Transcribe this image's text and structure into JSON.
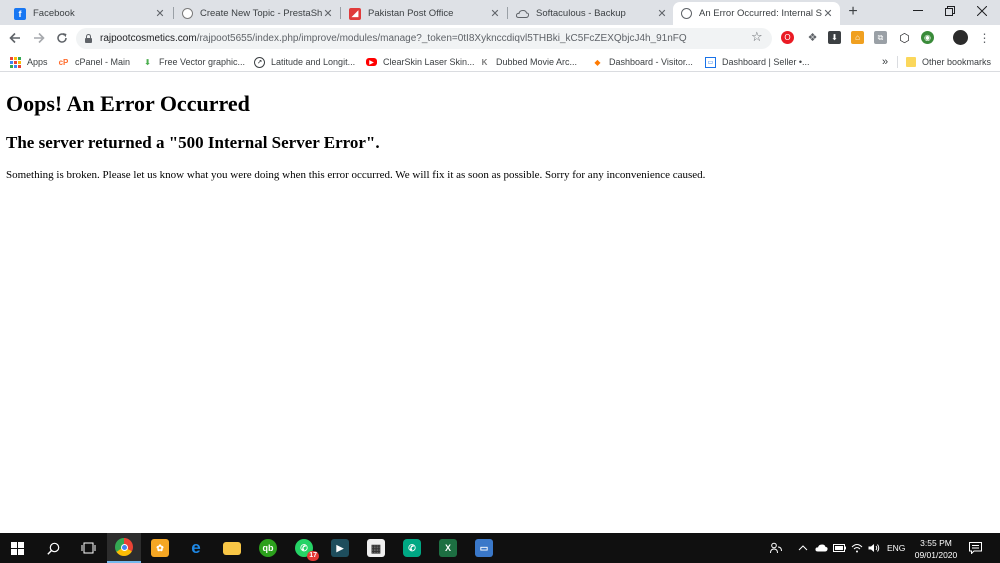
{
  "tabs": [
    {
      "title": "Facebook",
      "icon": "facebook-icon"
    },
    {
      "title": "Create New Topic - PrestaShop",
      "icon": "prestashop-icon"
    },
    {
      "title": "Pakistan Post Office",
      "icon": "pakistan-post-icon"
    },
    {
      "title": "Softaculous - Backup",
      "icon": "softaculous-icon"
    },
    {
      "title": "An Error Occurred: Internal Se",
      "icon": "globe-icon",
      "active": true
    }
  ],
  "address_bar": {
    "host": "rajpootcosmetics.com",
    "path": "/rajpoot5655/index.php/improve/modules/manage?_token=0tI8Xyknccdiqvl5THBki_kC5FcZEXQbjcJ4h_91nFQ"
  },
  "bookmarks": [
    {
      "label": "Apps",
      "icon": "apps-grid-icon"
    },
    {
      "label": "cPanel - Main",
      "icon": "cpanel-icon"
    },
    {
      "label": "Free Vector graphic...",
      "icon": "freevector-icon"
    },
    {
      "label": "Latitude and Longit...",
      "icon": "compass-icon"
    },
    {
      "label": "ClearSkin Laser Skin...",
      "icon": "youtube-icon"
    },
    {
      "label": "Dubbed Movie Arc...",
      "icon": "kodi-icon"
    },
    {
      "label": "Dashboard - Visitor...",
      "icon": "dashboard-icon"
    },
    {
      "label": "Dashboard | Seller •...",
      "icon": "seller-dashboard-icon"
    }
  ],
  "bookmarks_overflow": "»",
  "other_bookmarks": "Other bookmarks",
  "page": {
    "heading": "Oops! An Error Occurred",
    "subheading": "The server returned a \"500 Internal Server Error\".",
    "message": "Something is broken. Please let us know what you were doing when this error occurred. We will fix it as soon as possible. Sorry for any inconvenience caused."
  },
  "taskbar": {
    "whatsapp_badge": "17",
    "language": "ENG",
    "time": "3:55 PM",
    "date": "09/01/2020"
  },
  "colors": {
    "tabstrip": "#dee1e6",
    "taskbar": "#101010",
    "active_underline": "#76b9ed"
  }
}
